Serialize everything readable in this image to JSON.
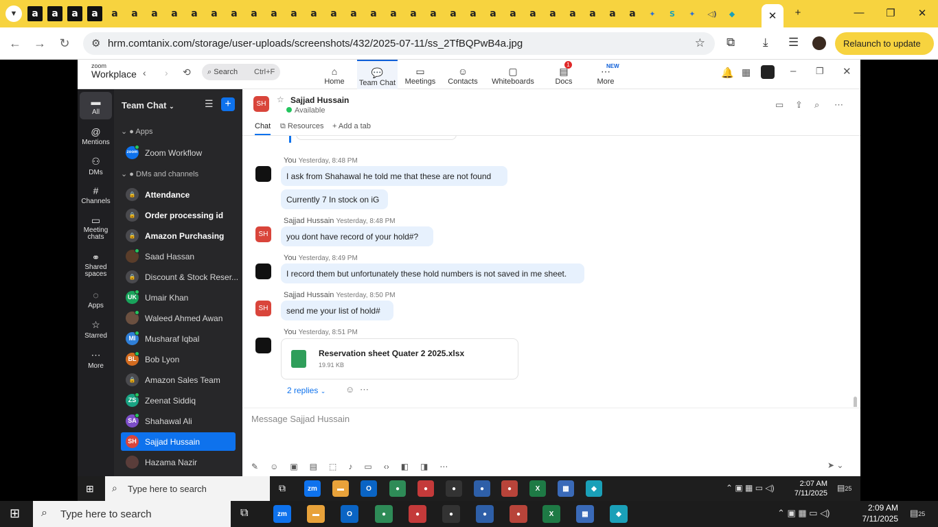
{
  "browser": {
    "favicons": [
      "a",
      "a",
      "a",
      "a",
      "a",
      "a",
      "a",
      "a",
      "a",
      "a",
      "a",
      "a",
      "a",
      "a",
      "a",
      "a",
      "a",
      "a",
      "a",
      "a",
      "a",
      "a",
      "a",
      "a",
      "a",
      "a",
      "a",
      "a",
      "a",
      "a",
      "a"
    ],
    "url": "hrm.comtanix.com/storage/user-uploads/screenshots/432/2025-07-11/ss_2TfBQPwB4a.jpg",
    "relaunch_label": "Relaunch to update"
  },
  "zoom": {
    "logo_top": "zoom",
    "logo_bottom": "Workplace",
    "search_label": "Search",
    "search_shortcut": "Ctrl+F",
    "tabs": [
      {
        "label": "Home"
      },
      {
        "label": "Team Chat"
      },
      {
        "label": "Meetings"
      },
      {
        "label": "Contacts"
      },
      {
        "label": "Whiteboards"
      },
      {
        "label": "Docs",
        "badge": "1"
      },
      {
        "label": "More",
        "tag": "NEW"
      }
    ],
    "rail": [
      {
        "label": "All"
      },
      {
        "label": "Mentions"
      },
      {
        "label": "DMs"
      },
      {
        "label": "Channels"
      },
      {
        "label": "Meeting chats"
      },
      {
        "label": "Shared spaces"
      },
      {
        "label": "Apps"
      },
      {
        "label": "Starred"
      },
      {
        "label": "More"
      }
    ],
    "sidebar": {
      "title": "Team Chat",
      "section_apps": "Apps",
      "section_dms": "DMs and channels",
      "items": [
        {
          "name": "Zoom Workflow",
          "initials": "zoom"
        },
        {
          "name": "Attendance"
        },
        {
          "name": "Order processing id"
        },
        {
          "name": "Amazon Purchasing"
        },
        {
          "name": "Saad Hassan"
        },
        {
          "name": "Discount & Stock Reser..."
        },
        {
          "name": "Umair Khan",
          "initials": "UK"
        },
        {
          "name": "Waleed Ahmed Awan"
        },
        {
          "name": "Musharaf Iqbal",
          "initials": "MI"
        },
        {
          "name": "Bob Lyon",
          "initials": "BL"
        },
        {
          "name": "Amazon Sales Team"
        },
        {
          "name": "Zeenat Siddiq",
          "initials": "ZS"
        },
        {
          "name": "Shahawal Ali",
          "initials": "SA"
        },
        {
          "name": "Sajjad Hussain",
          "initials": "SH"
        },
        {
          "name": "Hazama Nazir"
        }
      ]
    },
    "chat": {
      "contact_name": "Sajjad Hussain",
      "contact_initials": "SH",
      "status": "Available",
      "tabs": [
        "Chat",
        "Resources",
        "+ Add a tab"
      ],
      "messages": [
        {
          "sender": "You",
          "time": "Yesterday, 8:48 PM",
          "bubbles": [
            "I ask from Shahawal he told me that these are not found",
            "Currently 7 In stock on iG"
          ]
        },
        {
          "sender": "Sajjad Hussain",
          "time": "Yesterday, 8:48 PM",
          "bubbles": [
            "you dont have record of your hold#?"
          ]
        },
        {
          "sender": "You",
          "time": "Yesterday, 8:49 PM",
          "bubbles": [
            "I record them but unfortunately these hold numbers is not saved in me sheet."
          ]
        },
        {
          "sender": "Sajjad Hussain",
          "time": "Yesterday, 8:50 PM",
          "bubbles": [
            "send me your list of hold#"
          ]
        },
        {
          "sender": "You",
          "time": "Yesterday, 8:51 PM",
          "file": {
            "name": "Reservation sheet Quater 2 2025.xlsx",
            "size": "19.91 KB"
          }
        }
      ],
      "replies": "2 replies",
      "compose_placeholder": "Message Sajjad Hussain"
    }
  },
  "taskbar_inner": {
    "search": "Type here to search",
    "time": "2:07 AM",
    "date": "7/11/2025",
    "notif": "25"
  },
  "taskbar_outer": {
    "search": "Type here to search",
    "time": "2:09 AM",
    "date": "7/11/2025",
    "notif": "25"
  }
}
